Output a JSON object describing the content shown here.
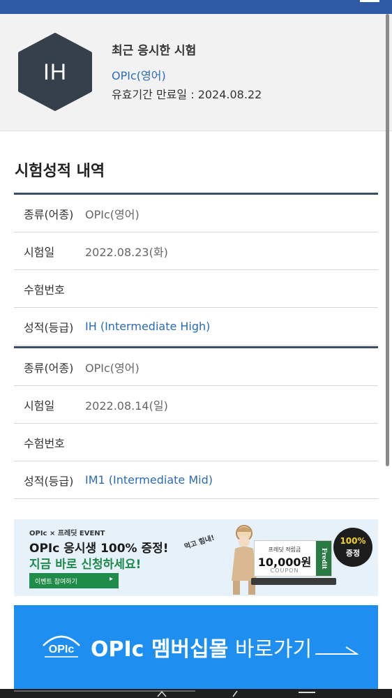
{
  "profile": {
    "grade_badge": "IH",
    "recent_title": "최근 응시한 시험",
    "recent_exam": "OPIc(영어)",
    "expiry": "유효기간 만료일 : 2024.08.22"
  },
  "section_title": "시험성적 내역",
  "records": [
    {
      "rows": [
        {
          "label": "종류(어종)",
          "value": "OPIc(영어)"
        },
        {
          "label": "시험일",
          "value": "2022.08.23(화)"
        },
        {
          "label": "수험번호",
          "value": ""
        },
        {
          "label": "성적(등급)",
          "value": "IH (Intermediate High)"
        }
      ]
    },
    {
      "rows": [
        {
          "label": "종류(어종)",
          "value": "OPIc(영어)"
        },
        {
          "label": "시험일",
          "value": "2022.08.14(일)"
        },
        {
          "label": "수험번호",
          "value": ""
        },
        {
          "label": "성적(등급)",
          "value": "IM1 (Intermediate Mid)"
        }
      ]
    }
  ],
  "event_banner": {
    "event_tag": "OPIc × 프레딧 EVENT",
    "line1": "OPIc 응시생 100% 증정!",
    "line2": "지금 바로 신청하세요!",
    "button": "이벤트 참여하기",
    "speech": "먹고 힘내!",
    "coupon_title": "프레딧 적립금",
    "coupon_amount": "10,000원",
    "coupon_label": "COUPON",
    "coupon_brand": "Fredit",
    "badge_pct": "100%",
    "badge_gift": "증정"
  },
  "member_banner": {
    "text_bold": "OPIc 멤버십몰",
    "text_normal": "바로가기"
  },
  "colors": {
    "topbar": "#2e5aa6",
    "hexagon": "#36404d",
    "link_blue": "#2a6bb5",
    "table_rule": "#3d4d63",
    "member_banner": "#1e8ff0",
    "event_green": "#1f8c4a"
  }
}
